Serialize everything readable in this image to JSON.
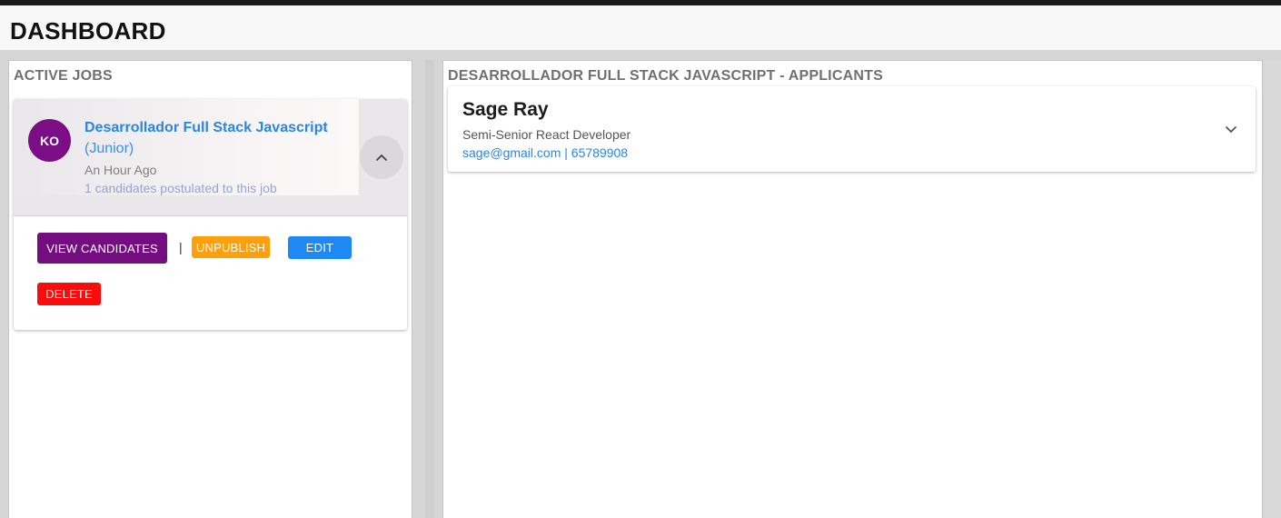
{
  "page": {
    "title": "DASHBOARD"
  },
  "active_jobs": {
    "title": "ACTIVE JOBS",
    "job": {
      "avatar_initials": "KO",
      "title": "Desarrollador Full Stack Javascript",
      "level": "(Junior)",
      "posted": "An Hour Ago",
      "candidates_text": "1 candidates postulated to this job",
      "collapse_icon": "chevron-up-icon",
      "actions": {
        "view": "VIEW CANDIDATES",
        "separator": "|",
        "unpublish": "UNPUBLISH",
        "edit": "EDIT",
        "delete": "DELETE"
      }
    }
  },
  "applicants": {
    "title": "DESARROLLADOR FULL STACK JAVASCRIPT - APPLICANTS",
    "items": [
      {
        "name": "Sage Ray",
        "role": "Semi-Senior React Developer",
        "contact": "sage@gmail.com | 65789908",
        "expand_icon": "chevron-down-icon"
      }
    ]
  },
  "colors": {
    "avatar": "#7b0e84",
    "view_button": "#740d80",
    "unpublish_button": "#ff9f0a",
    "edit_button": "#1e88f5",
    "delete_button": "#f80c0c",
    "link": "#2a86e2"
  }
}
